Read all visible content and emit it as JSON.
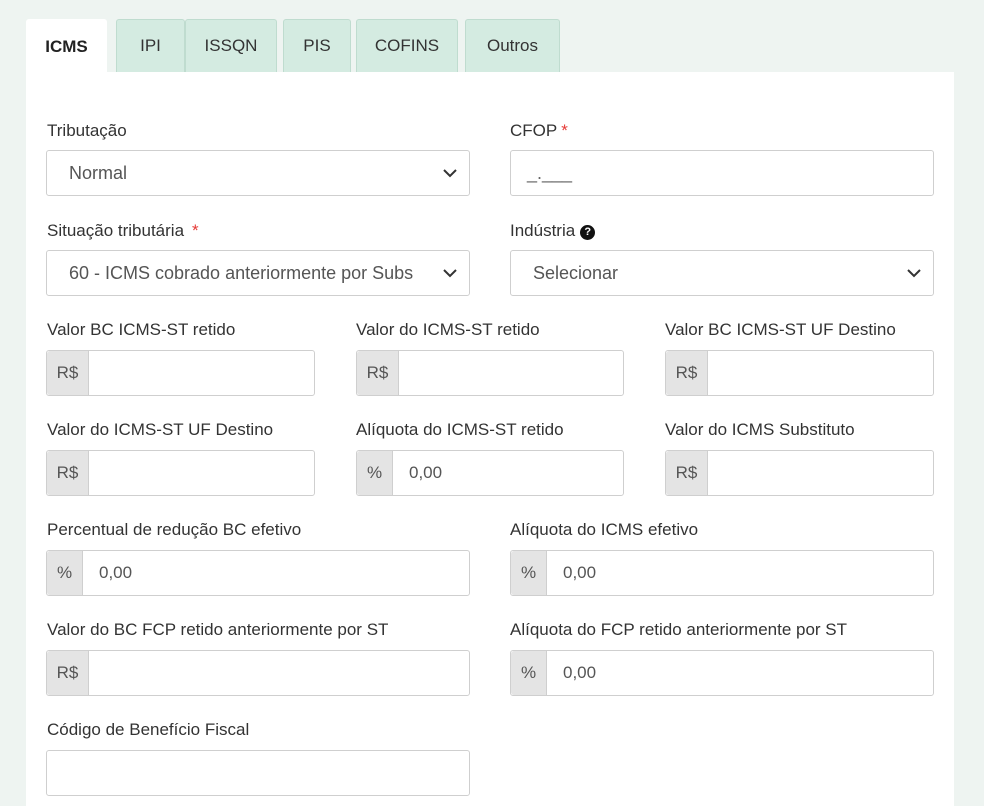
{
  "tabs": [
    {
      "label": "ICMS",
      "active": true
    },
    {
      "label": "IPI"
    },
    {
      "label": "ISSQN"
    },
    {
      "label": "PIS"
    },
    {
      "label": "COFINS"
    },
    {
      "label": "Outros"
    }
  ],
  "form": {
    "tributacao": {
      "label": "Tributação",
      "value": "Normal"
    },
    "cfop": {
      "label": "CFOP",
      "required": "*",
      "value": "_.___"
    },
    "situacao": {
      "label": "Situação tributária",
      "required": "*",
      "value": "60 - ICMS cobrado anteriormente por Subs"
    },
    "industria": {
      "label": "Indústria",
      "help_icon": "?",
      "value": "Selecionar"
    },
    "valor_bc_icms_st_retido": {
      "label": "Valor BC ICMS-ST retido",
      "addon": "R$",
      "value": ""
    },
    "valor_icms_st_retido": {
      "label": "Valor do ICMS-ST retido",
      "addon": "R$",
      "value": ""
    },
    "valor_bc_icms_st_uf_destino": {
      "label": "Valor BC ICMS-ST UF Destino",
      "addon": "R$",
      "value": ""
    },
    "valor_icms_st_uf_destino": {
      "label": "Valor do ICMS-ST UF Destino",
      "addon": "R$",
      "value": ""
    },
    "aliquota_icms_st_retido": {
      "label": "Alíquota do ICMS-ST retido",
      "addon": "%",
      "value": "0,00"
    },
    "valor_icms_substituto": {
      "label": "Valor do ICMS Substituto",
      "addon": "R$",
      "value": ""
    },
    "percentual_reducao_bc": {
      "label": "Percentual de redução BC efetivo",
      "addon": "%",
      "value": "0,00"
    },
    "aliquota_icms_efetivo": {
      "label": "Alíquota do ICMS efetivo",
      "addon": "%",
      "value": "0,00"
    },
    "valor_bc_fcp_retido": {
      "label": "Valor do BC FCP retido anteriormente por ST",
      "addon": "R$",
      "value": ""
    },
    "aliquota_fcp_retido": {
      "label": "Alíquota do FCP retido anteriormente por ST",
      "addon": "%",
      "value": "0,00"
    },
    "codigo_beneficio": {
      "label": "Código de Benefício Fiscal",
      "value": ""
    }
  }
}
